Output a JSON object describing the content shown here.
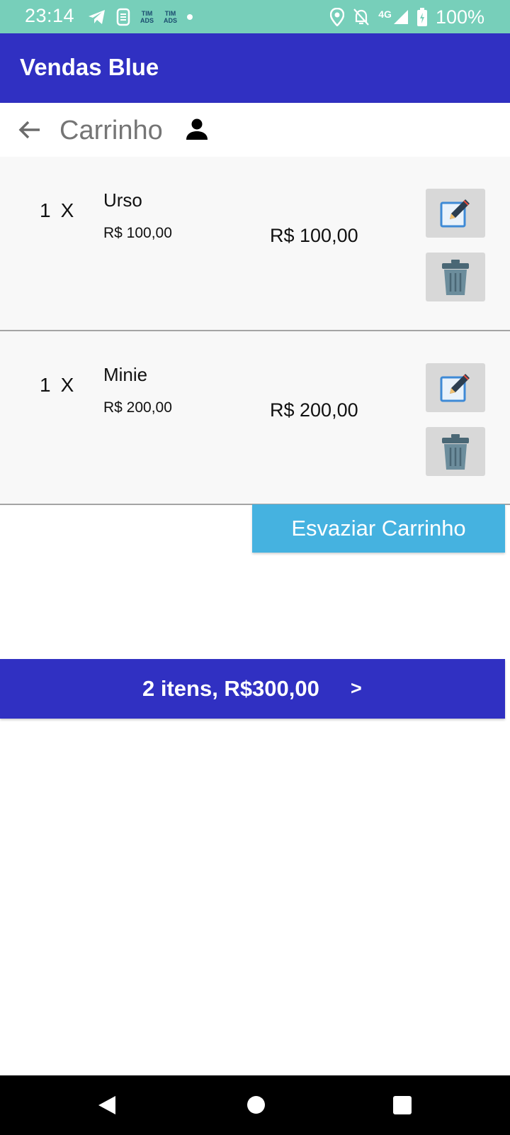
{
  "status_bar": {
    "time": "23:14",
    "carrier_1": [
      "TIM",
      "ADS"
    ],
    "carrier_2": [
      "TIM",
      "ADS"
    ],
    "network": "4G",
    "battery": "100%"
  },
  "app_bar": {
    "title": "Vendas Blue"
  },
  "toolbar": {
    "title": "Carrinho"
  },
  "cart": {
    "items": [
      {
        "quantity": "1",
        "x": "X",
        "name": "Urso",
        "unit_price": "R$ 100,00",
        "total_price": "R$ 100,00"
      },
      {
        "quantity": "1",
        "x": "X",
        "name": "Minie",
        "unit_price": "R$ 200,00",
        "total_price": "R$ 200,00"
      }
    ]
  },
  "actions": {
    "empty_cart": "Esvaziar Carrinho"
  },
  "summary": {
    "text": "2 itens, R$300,00",
    "arrow": ">"
  },
  "colors": {
    "status_bar": "#77cfba",
    "app_bar": "#3030c2",
    "empty_button": "#45b2e0",
    "summary_bar": "#3030c2"
  }
}
